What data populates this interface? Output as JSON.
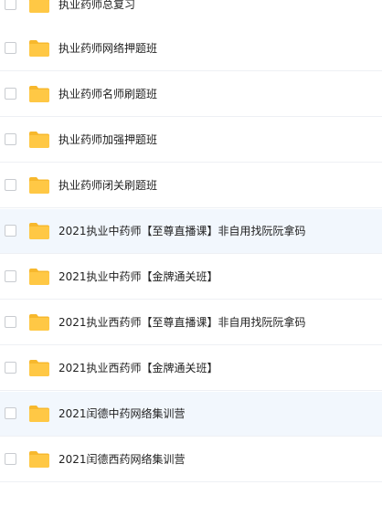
{
  "files": [
    {
      "name": "执业药师总复习"
    },
    {
      "name": "执业药师网络押题班"
    },
    {
      "name": "执业药师名师刷题班"
    },
    {
      "name": "执业药师加强押题班"
    },
    {
      "name": "执业药师闭关刷题班"
    },
    {
      "name": "2021执业中药师【至尊直播课】非自用找阮阮拿码"
    },
    {
      "name": "2021执业中药师【金牌通关班】"
    },
    {
      "name": "2021执业西药师【至尊直播课】非自用找阮阮拿码"
    },
    {
      "name": "2021执业西药师【金牌通关班】"
    },
    {
      "name": "2021闰德中药网络集训营"
    },
    {
      "name": "2021闰德西药网络集训营"
    }
  ],
  "folder_icon": "folder-icon",
  "colors": {
    "folder": "#ffc845",
    "folder_tab": "#f7b82d",
    "row_highlight": "#f2f7fd",
    "text": "#222222"
  }
}
